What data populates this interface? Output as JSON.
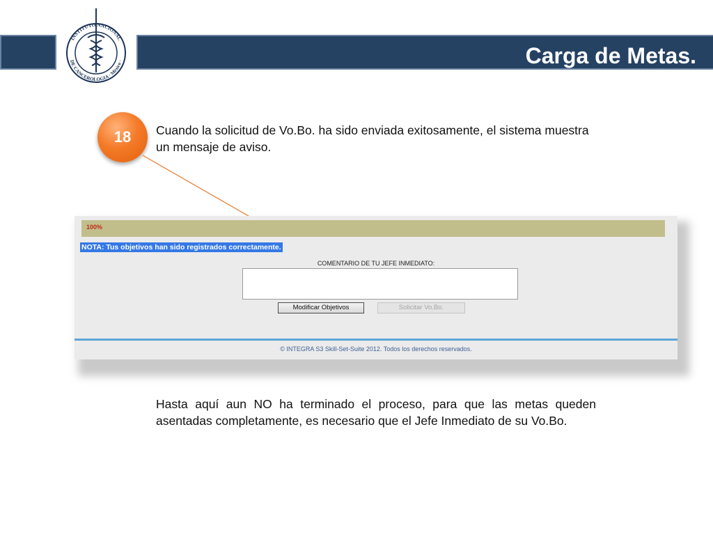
{
  "header": {
    "title": "Carga de Metas."
  },
  "logo": {
    "top_text": "INSTITUTO NACIONAL",
    "bottom_text": "DE CANCEROLOGIA · México ·",
    "icon": "caduceus-icon"
  },
  "step": {
    "number": "18",
    "text": "Cuando la solicitud de Vo.Bo. ha sido enviada exitosamente, el sistema muestra un mensaje de aviso."
  },
  "screenshot": {
    "progress_label": "100%",
    "nota_message": "NOTA: Tus objetivos han sido registrados correctamente.",
    "comment_label": "COMENTARIO DE TU JEFE INMEDIATO:",
    "comment_value": "",
    "modify_button": "Modificar Objetivos",
    "request_button": "Solicitar Vo.Bo.",
    "footer": "© INTEGRA S3 Skill-Set-Suite 2012. Todos los derechos reservados."
  },
  "note": {
    "text": "Hasta aquí aun NO ha terminado el proceso, para que las metas queden asentadas completamente,  es necesario que el Jefe Inmediato de su Vo.Bo."
  },
  "colors": {
    "header_bar": "#254263",
    "badge": "#f47b28",
    "progress_strip": "#c2be8c",
    "nota_highlight": "#3578e5"
  }
}
